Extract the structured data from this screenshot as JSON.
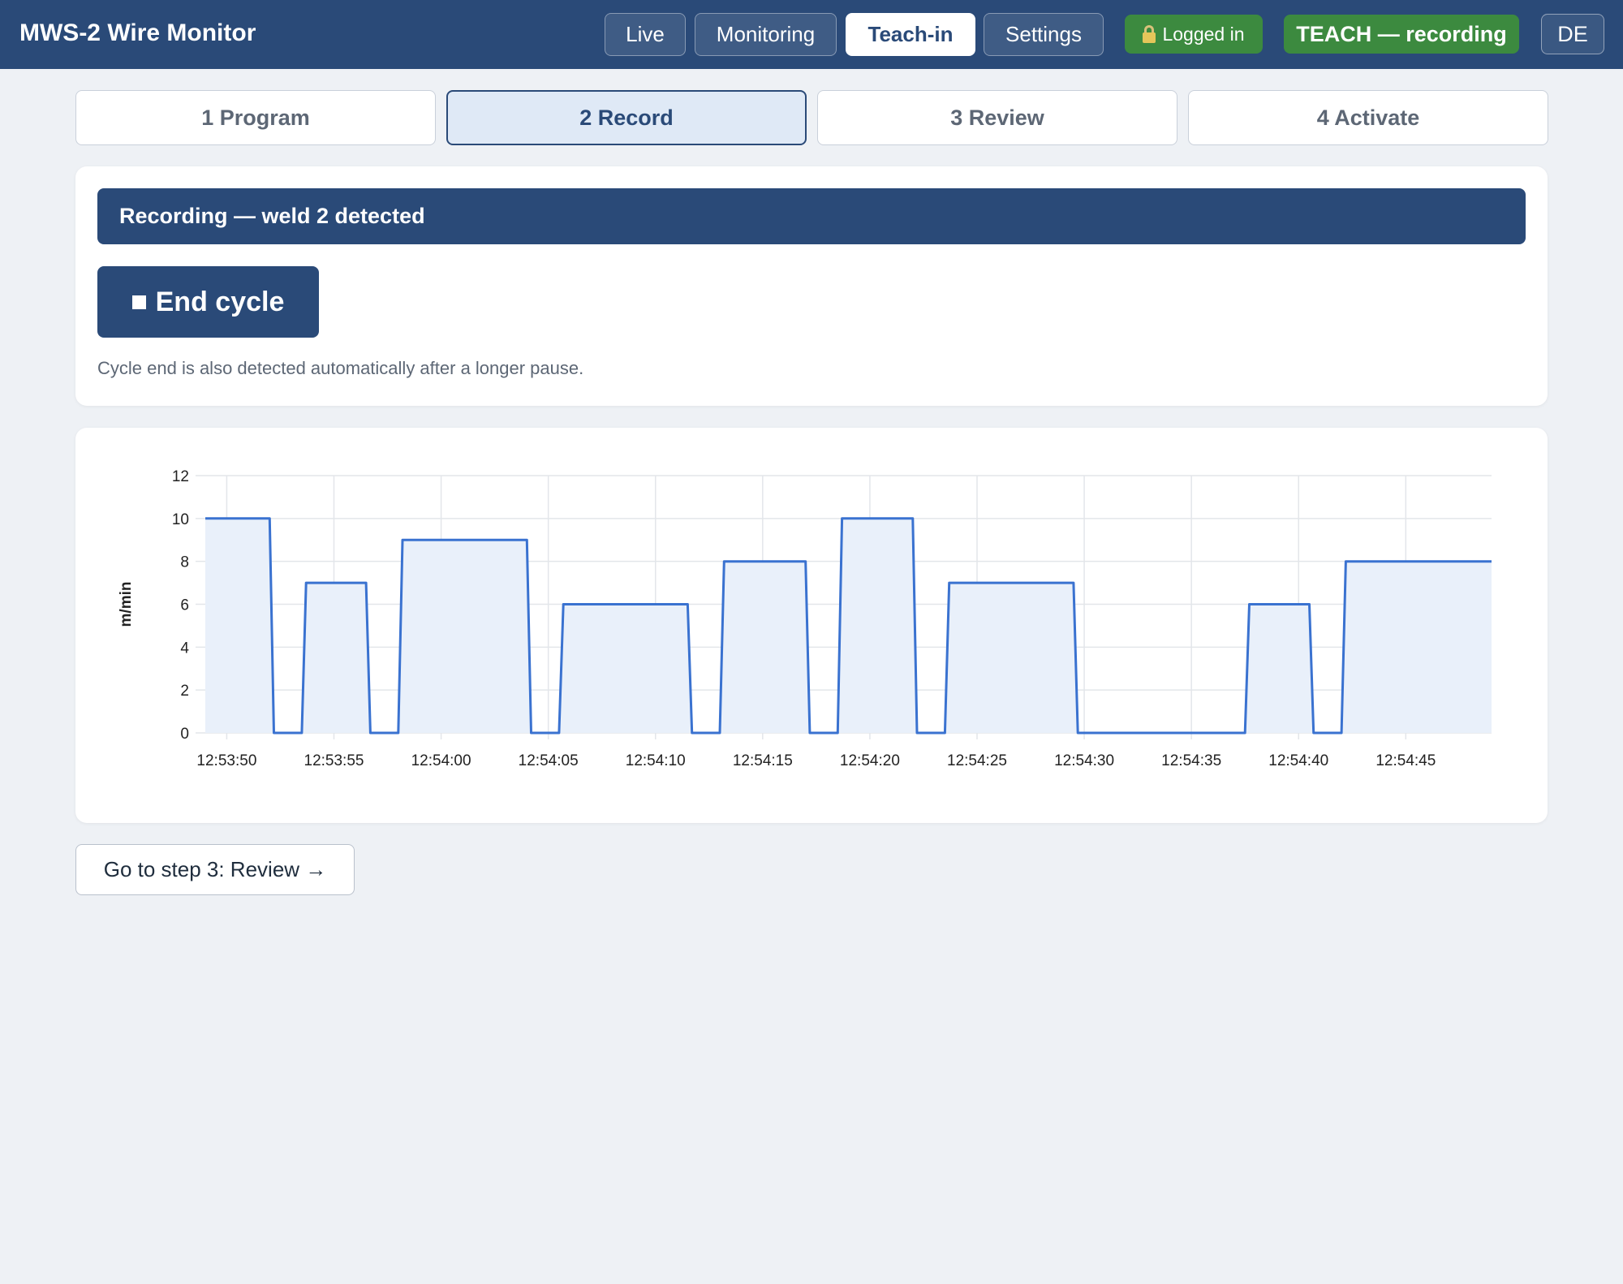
{
  "header": {
    "title": "MWS-2 Wire Monitor",
    "nav": [
      {
        "label": "Live",
        "active": false
      },
      {
        "label": "Monitoring",
        "active": false
      },
      {
        "label": "Teach-in",
        "active": true
      },
      {
        "label": "Settings",
        "active": false
      }
    ],
    "login_status": "Logged in",
    "mode_badge": "TEACH — recording",
    "language": "DE"
  },
  "steps": [
    {
      "label": "1 Program",
      "active": false
    },
    {
      "label": "2 Record",
      "active": true
    },
    {
      "label": "3 Review",
      "active": false
    },
    {
      "label": "4 Activate",
      "active": false
    }
  ],
  "recording": {
    "banner": "Recording — weld 2 detected",
    "end_button": "End cycle",
    "hint": "Cycle end is also detected automatically after a longer pause."
  },
  "chart_data": {
    "type": "area",
    "ylabel": "m/min",
    "ylim": [
      0,
      12
    ],
    "yticks": [
      0,
      2,
      4,
      6,
      8,
      10,
      12
    ],
    "x_start": "12:53:49",
    "x_end": "12:54:49",
    "xticks": [
      "12:53:50",
      "12:53:55",
      "12:54:00",
      "12:54:05",
      "12:54:10",
      "12:54:15",
      "12:54:20",
      "12:54:25",
      "12:54:30",
      "12:54:35",
      "12:54:40",
      "12:54:45"
    ],
    "grid": true,
    "colors": {
      "line": "#3a72d0",
      "fill": "#e9f0fa",
      "grid": "#e3e6ea"
    },
    "series": [
      {
        "x": [
          "12:53:49.0",
          "12:53:52.0",
          "12:53:52.2",
          "12:53:53.5",
          "12:53:53.7",
          "12:53:56.5",
          "12:53:56.7",
          "12:53:58.0",
          "12:53:58.2",
          "12:54:04.0",
          "12:54:04.2",
          "12:54:05.5",
          "12:54:05.7",
          "12:54:11.5",
          "12:54:11.7",
          "12:54:13.0",
          "12:54:13.2",
          "12:54:17.0",
          "12:54:17.2",
          "12:54:18.5",
          "12:54:18.7",
          "12:54:22.0",
          "12:54:22.2",
          "12:54:23.5",
          "12:54:23.7",
          "12:54:29.5",
          "12:54:29.7",
          "12:54:37.5",
          "12:54:37.7",
          "12:54:40.5",
          "12:54:40.7",
          "12:54:42.0",
          "12:54:42.2",
          "12:54:49.0"
        ],
        "values": [
          10,
          10,
          0,
          0,
          7,
          7,
          0,
          0,
          9,
          9,
          0,
          0,
          6,
          6,
          0,
          0,
          8,
          8,
          0,
          0,
          10,
          10,
          0,
          0,
          7,
          7,
          0,
          0,
          6,
          6,
          0,
          0,
          8,
          8
        ]
      }
    ]
  },
  "footer": {
    "next_button": "Go to step 3: Review →"
  }
}
